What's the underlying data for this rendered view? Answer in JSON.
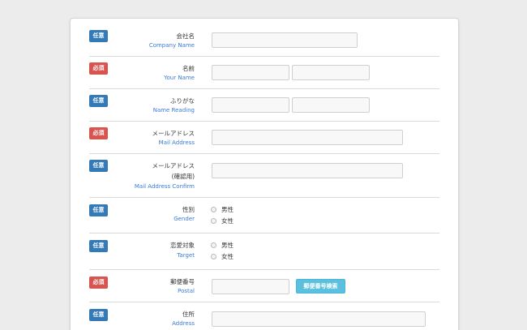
{
  "badges": {
    "optional": "任意",
    "required": "必須"
  },
  "fields": {
    "company": {
      "jp": "会社名",
      "en": "Company Name"
    },
    "name": {
      "jp": "名前",
      "en": "Your Name"
    },
    "reading": {
      "jp": "ふりがな",
      "en": "Name Reading"
    },
    "mail": {
      "jp": "メールアドレス",
      "en": "Mail Address"
    },
    "mail_confirm": {
      "jp": "メールアドレス",
      "sub": "(確認用)",
      "en": "Mail Address Confirm"
    },
    "gender": {
      "jp": "性別",
      "en": "Gender",
      "options": [
        "男性",
        "女性"
      ]
    },
    "target": {
      "jp": "恋愛対象",
      "en": "Target",
      "options": [
        "男性",
        "女性"
      ]
    },
    "postal": {
      "jp": "郵便番号",
      "en": "Postal",
      "button": "郵便番号検索"
    },
    "address": {
      "jp": "住所",
      "en": "Address"
    }
  },
  "colors": {
    "optional_badge": "#337ab7",
    "required_badge": "#d9534f",
    "search_button": "#5bc0de",
    "english_label": "#3a7bd5"
  }
}
